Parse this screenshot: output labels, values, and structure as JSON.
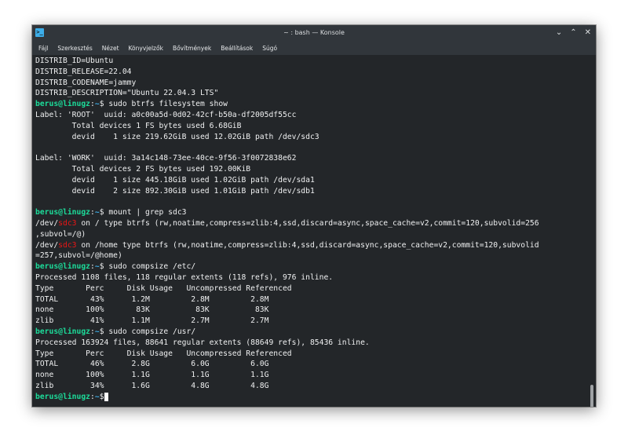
{
  "window": {
    "title": "~ : bash — Konsole",
    "icon": "konsole-icon",
    "buttons": {
      "minimize": "⌄",
      "maximize": "⌃",
      "close": "✕"
    }
  },
  "menu": [
    "Fájl",
    "Szerkesztés",
    "Nézet",
    "Könyvjelzők",
    "Bővítmények",
    "Beállítások",
    "Súgó"
  ],
  "prompt": {
    "user": "berus@linugz",
    "sep": ":",
    "path": "~",
    "dollar": "$"
  },
  "colors": {
    "user": "#1cdc9a",
    "path": "#3daee9",
    "highlight": "#ed1515",
    "bg": "#232629",
    "fg": "#eff0f1"
  },
  "lines": [
    {
      "text": "DISTRIB_ID=Ubuntu"
    },
    {
      "text": "DISTRIB_RELEASE=22.04"
    },
    {
      "text": "DISTRIB_CODENAME=jammy"
    },
    {
      "text": "DISTRIB_DESCRIPTION=\"Ubuntu 22.04.3 LTS\""
    },
    {
      "prompt": true,
      "cmd": " sudo btrfs filesystem show"
    },
    {
      "text": "Label: 'ROOT'  uuid: a0c00a5d-0d02-42cf-b50a-df2005df55cc"
    },
    {
      "text": "        Total devices 1 FS bytes used 6.68GiB"
    },
    {
      "text": "        devid    1 size 219.62GiB used 12.02GiB path /dev/sdc3"
    },
    {
      "text": ""
    },
    {
      "text": "Label: 'WORK'  uuid: 3a14c148-73ee-40ce-9f56-3f0072838e62"
    },
    {
      "text": "        Total devices 2 FS bytes used 192.00KiB"
    },
    {
      "text": "        devid    1 size 445.18GiB used 1.02GiB path /dev/sda1"
    },
    {
      "text": "        devid    2 size 892.30GiB used 1.01GiB path /dev/sdb1"
    },
    {
      "text": ""
    },
    {
      "prompt": true,
      "cmd": " mount | grep sdc3"
    },
    {
      "pre": "/dev/",
      "hl": "sdc3",
      "post": " on / type btrfs (rw,noatime,compress=zlib:4,ssd,discard=async,space_cache=v2,commit=120,subvolid=256"
    },
    {
      "text": ",subvol=/@)"
    },
    {
      "pre": "/dev/",
      "hl": "sdc3",
      "post": " on /home type btrfs (rw,noatime,compress=zlib:4,ssd,discard=async,space_cache=v2,commit=120,subvolid"
    },
    {
      "text": "=257,subvol=/@home)"
    },
    {
      "prompt": true,
      "cmd": " sudo compsize /etc/"
    },
    {
      "text": "Processed 1108 files, 118 regular extents (118 refs), 976 inline."
    },
    {
      "text": "Type       Perc     Disk Usage   Uncompressed Referenced"
    },
    {
      "text": "TOTAL       43%      1.2M         2.8M         2.8M"
    },
    {
      "text": "none       100%       83K          83K          83K"
    },
    {
      "text": "zlib        41%      1.1M         2.7M         2.7M"
    },
    {
      "prompt": true,
      "cmd": " sudo compsize /usr/"
    },
    {
      "text": "Processed 163924 files, 88641 regular extents (88649 refs), 85436 inline."
    },
    {
      "text": "Type       Perc     Disk Usage   Uncompressed Referenced"
    },
    {
      "text": "TOTAL       46%      2.8G         6.0G         6.0G"
    },
    {
      "text": "none       100%      1.1G         1.1G         1.1G"
    },
    {
      "text": "zlib        34%      1.6G         4.8G         4.8G"
    },
    {
      "prompt": true,
      "cmd": "",
      "cursor": true
    }
  ]
}
